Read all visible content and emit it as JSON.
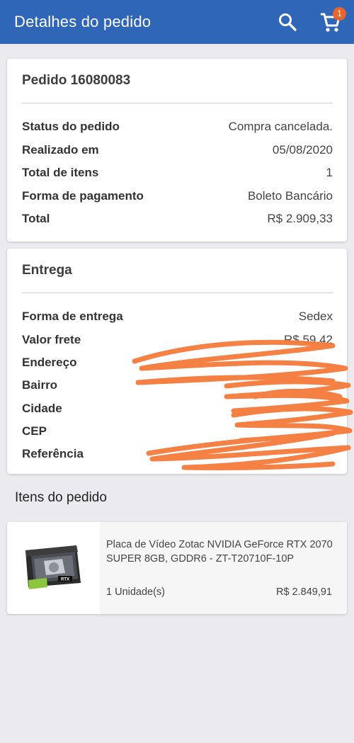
{
  "header": {
    "title": "Detalhes do pedido",
    "cart_badge": "1",
    "search_icon": "search-icon",
    "cart_icon": "cart-icon"
  },
  "order": {
    "title": "Pedido 16080083",
    "rows": [
      {
        "label": "Status do pedido",
        "value": "Compra cancelada."
      },
      {
        "label": "Realizado em",
        "value": "05/08/2020"
      },
      {
        "label": "Total de itens",
        "value": "1"
      },
      {
        "label": "Forma de pagamento",
        "value": "Boleto Bancário"
      },
      {
        "label": "Total",
        "value": "R$ 2.909,33"
      }
    ]
  },
  "delivery": {
    "title": "Entrega",
    "rows": [
      {
        "label": "Forma de entrega",
        "value": "Sedex"
      },
      {
        "label": "Valor frete",
        "value": "R$ 59,42"
      },
      {
        "label": "Endereço",
        "value": ""
      },
      {
        "label": "Bairro",
        "value": ""
      },
      {
        "label": "Cidade",
        "value": ""
      },
      {
        "label": "CEP",
        "value": ""
      },
      {
        "label": "Referência",
        "value": ""
      }
    ]
  },
  "items_section": {
    "title": "Itens do pedido",
    "items": [
      {
        "name": "Placa de Vídeo Zotac NVIDIA GeForce RTX 2070 SUPER 8GB, GDDR6 - ZT-T20710F-10P",
        "quantity": "1 Unidade(s)",
        "price": "R$ 2.849,91",
        "thumb_box_label": "RTX"
      }
    ]
  },
  "colors": {
    "app_bar": "#2f66b7",
    "badge": "#e8642c",
    "scribble": "#f47a3a",
    "background": "#ebebef"
  }
}
